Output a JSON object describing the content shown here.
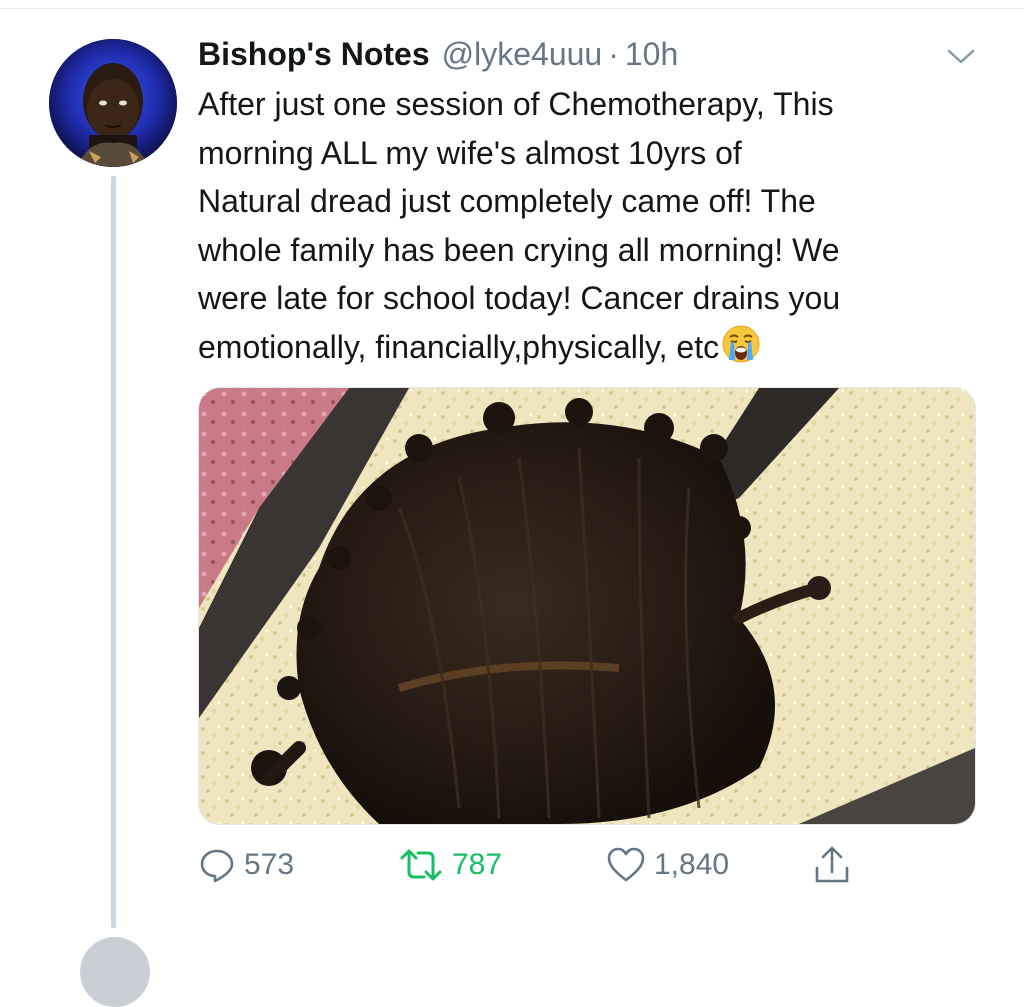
{
  "tweet": {
    "author_name": "Bishop's Notes",
    "handle": "@lyke4uuu",
    "separator": "·",
    "time": "10h",
    "text_lines": [
      "After just one session of Chemotherapy, This",
      "morning ALL my wife's almost 10yrs of",
      "Natural dread just completely came off! The",
      "whole family has been crying all morning! We",
      "were late for school today! Cancer drains you",
      "emotionally, financially,physically, etc"
    ],
    "emoji": "loudly-crying-face"
  },
  "actions": {
    "replies": "573",
    "retweets": "787",
    "likes": "1,840"
  },
  "icons": {
    "reply": "reply-icon",
    "retweet": "retweet-icon",
    "like": "heart-icon",
    "share": "share-icon",
    "more": "chevron-down-icon"
  },
  "colors": {
    "text": "#14171a",
    "secondary": "#657786",
    "retweet_active": "#17bf63",
    "thread_line": "#ccd6dd"
  }
}
